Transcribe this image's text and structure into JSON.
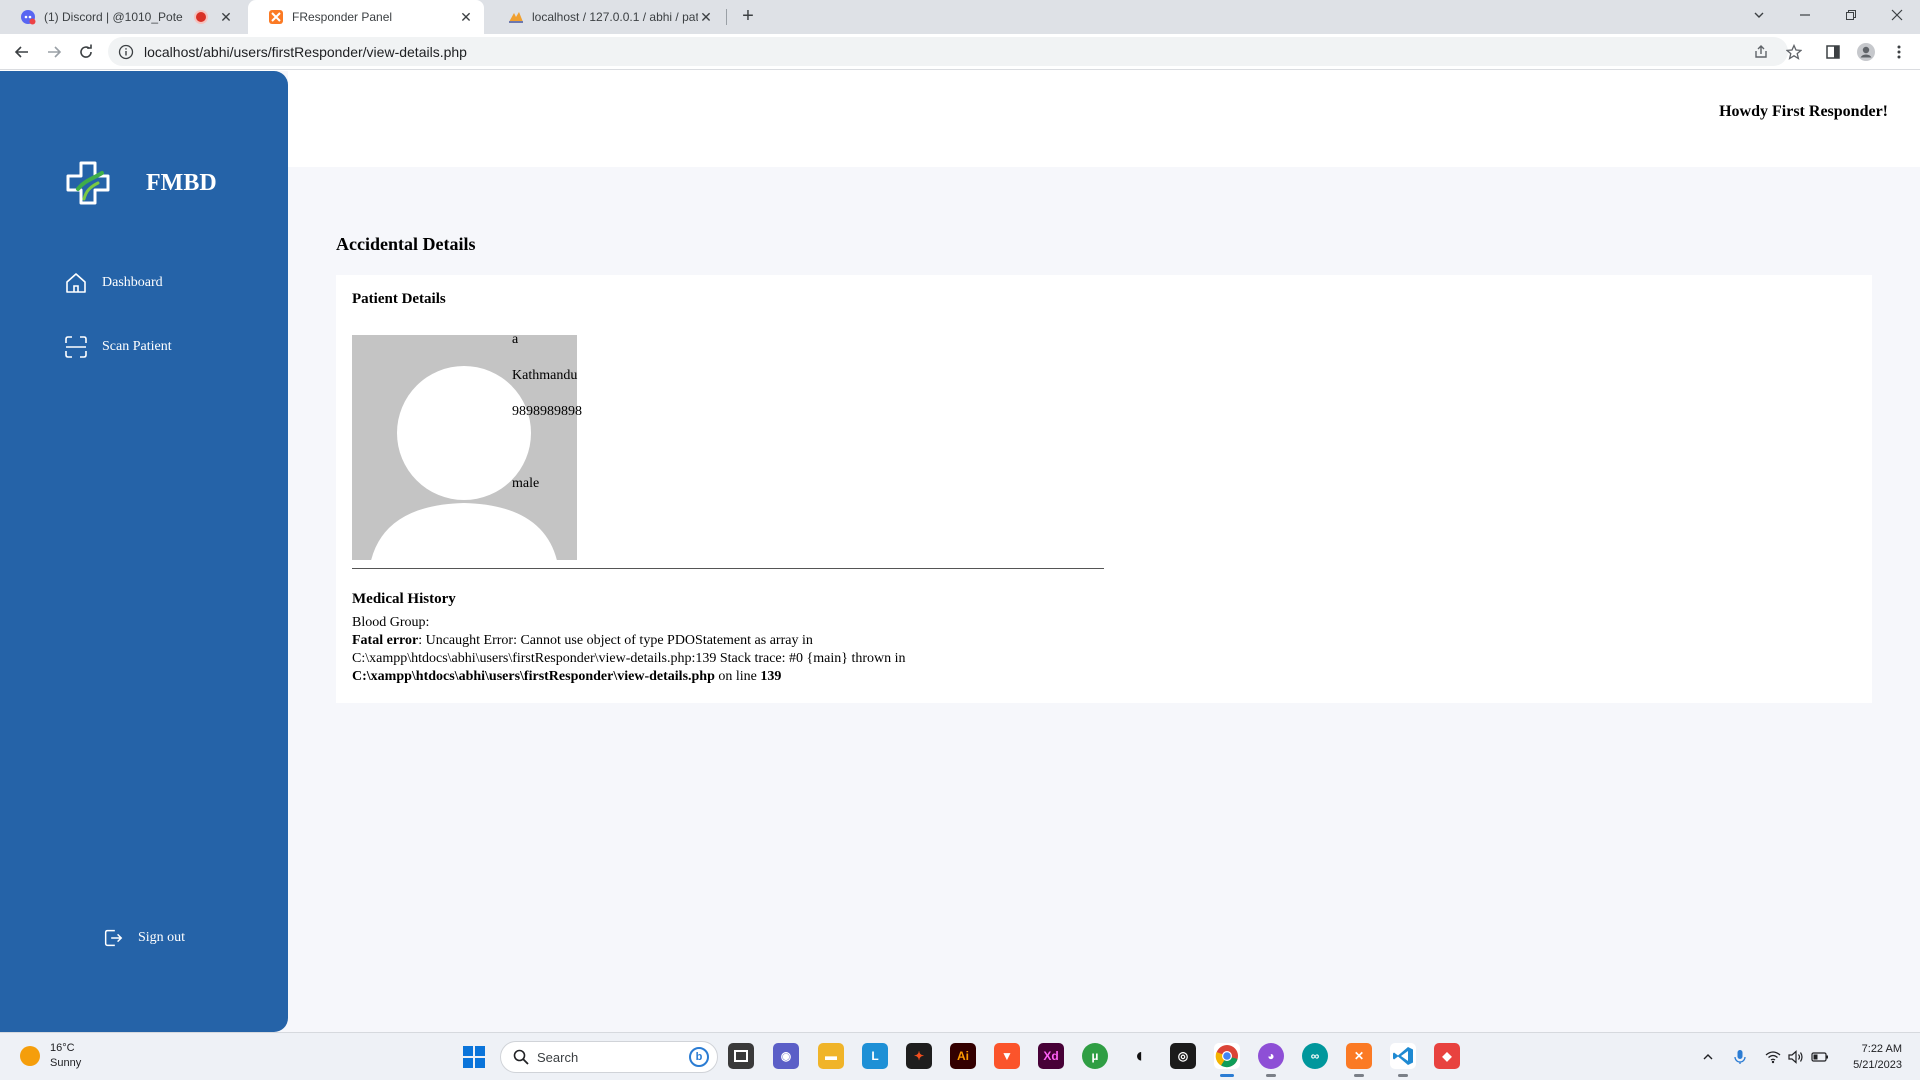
{
  "browser": {
    "tabs": [
      {
        "title": "(1) Discord | @1010_Pote",
        "active": false
      },
      {
        "title": "FResponder Panel",
        "active": true
      },
      {
        "title": "localhost / 127.0.0.1 / abhi / patie",
        "active": false
      }
    ],
    "url": "localhost/abhi/users/firstResponder/view-details.php"
  },
  "sidebar": {
    "brand": "FMBD",
    "items": [
      {
        "label": "Dashboard",
        "icon": "home-icon"
      },
      {
        "label": "Scan Patient",
        "icon": "scan-icon"
      }
    ],
    "signout_label": "Sign out"
  },
  "header": {
    "greeting": "Howdy First Responder!"
  },
  "main": {
    "title": "Accidental Details",
    "patient_section_title": "Patient Details",
    "patient": {
      "name": "a",
      "address": "Kathmandu",
      "phone": "9898989898",
      "gender": "male"
    },
    "medical_section_title": "Medical History",
    "blood_group_label": "Blood Group:",
    "error": {
      "prefix": "Fatal error",
      "message": ": Uncaught Error: Cannot use object of type PDOStatement as array in",
      "trace": "C:\\xampp\\htdocs\\abhi\\users\\firstResponder\\view-details.php:139 Stack trace: #0 {main} thrown in",
      "file": "C:\\xampp\\htdocs\\abhi\\users\\firstResponder\\view-details.php",
      "on_line_text": " on line ",
      "line": "139"
    }
  },
  "taskbar": {
    "weather_temp": "16°C",
    "weather_desc": "Sunny",
    "search_placeholder": "Search",
    "time": "7:22 AM",
    "date": "5/21/2023"
  },
  "colors": {
    "sidebar": "#2563a8",
    "page_bg": "#f6f7fb",
    "avatar_bg": "#c4c4c4"
  }
}
